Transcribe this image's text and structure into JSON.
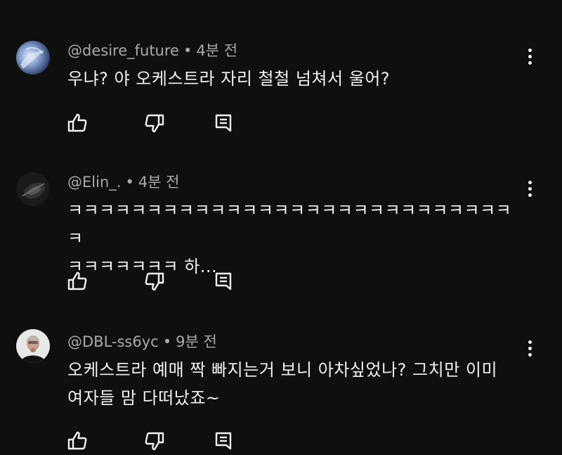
{
  "comments": [
    {
      "author": "@desire_future",
      "separator": "•",
      "time": "4분 전",
      "text": "우냐? 야 오케스트라 자리 철철 넘쳐서 울어?",
      "avatar_icon": "blue-abstract-avatar"
    },
    {
      "author": "@Elin_.",
      "separator": "•",
      "time": "4분 전",
      "text": "ㅋㅋㅋㅋㅋㅋㅋㅋㅋㅋㅋㅋㅋㅋㅋㅋㅋㅋㅋㅋㅋㅋㅋㅋㅋㅋㅋㅋㅋ\nㅋㅋㅋㅋㅋㅋㅋ 하...",
      "avatar_icon": "dark-object-avatar"
    },
    {
      "author": "@DBL-ss6yc",
      "separator": "•",
      "time": "9분 전",
      "text": "오케스트라 예매 짝 빠지는거 보니 아차싶었나? 그치만 이미\n여자들 맘 다떠났죠~",
      "avatar_icon": "person-portrait-avatar"
    }
  ],
  "icons": {
    "like": "thumbs-up-icon",
    "dislike": "thumbs-down-icon",
    "reply": "reply-icon",
    "menu": "more-vert-icon"
  },
  "colors": {
    "background": "#0f0f0f",
    "text": "#f1f1f1",
    "meta": "#aaaaaa"
  }
}
